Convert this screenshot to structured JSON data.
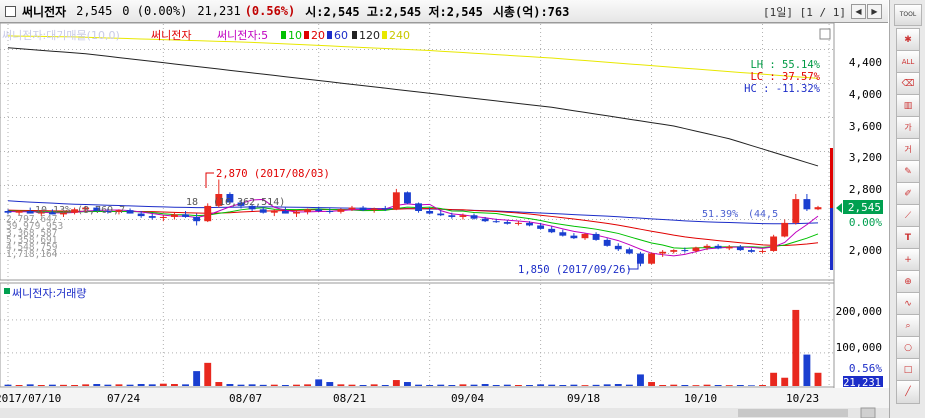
{
  "header": {
    "name": "써니전자",
    "price": "2,545",
    "change": "0 (0.00%)",
    "volume": "21,231",
    "volume_pct": "(0.56%)",
    "ohlc": "시:2,545 고:2,545 저:2,545",
    "mcap": "시총(억):763",
    "period": "[1일] [1 / 1]"
  },
  "legend": {
    "faded": "써니전자:대기매물(10,0)",
    "name": "써니전자",
    "ma_prefix": "써니전자:5",
    "ma10": "10",
    "ma20": "20",
    "ma60": "60",
    "ma120": "120",
    "ma240": "240"
  },
  "stats": {
    "lh": "LH :  55.14%",
    "lc": "LC :  37.57%",
    "hc": "HC : -11.32%"
  },
  "annotations": {
    "high": "2,870 (2017/08/03)",
    "low": "1,850 (2017/09/26)",
    "left1": "18",
    "left2": "(16,362,514)",
    "left3": "10.13%",
    "left4": "(8,769,7",
    "right1": "51.39%",
    "right2": "(44,5",
    "stack": [
      "2,797,647",
      "39,979,953",
      "3,368,587",
      "5,358,691",
      "4,548,759",
      "1,718,164"
    ]
  },
  "price_axis": [
    "4,400",
    "4,000",
    "3,600",
    "3,200",
    "2,800",
    "2,400",
    "2,000"
  ],
  "price_tag": "2,545",
  "pct_tag": "0.00%",
  "volume_panel": {
    "title": "써니전자:거래량",
    "ticks": [
      "200,000",
      "100,000"
    ],
    "tag_pct": "0.56%",
    "tag_vol": "21,231"
  },
  "dates": [
    "2017/07/10",
    "07/24",
    "08/07",
    "08/21",
    "09/04",
    "09/18",
    "10/10",
    "10/23"
  ],
  "toolbar": {
    "top_label": "TOOL"
  },
  "colors": {
    "up": "#e8281e",
    "down": "#1a3fd0",
    "ma5": "#c000c0",
    "ma10": "#00c000",
    "ma20": "#e00000",
    "ma60": "#1c2dc8",
    "ma120": "#222222",
    "ma240": "#e8e800",
    "grid": "#b0b0b0"
  },
  "chart_data": {
    "type": "candlestick",
    "price_range": [
      1700,
      4700
    ],
    "candles": [
      [
        2500,
        2520,
        2460,
        2480
      ],
      [
        2480,
        2510,
        2450,
        2500
      ],
      [
        2500,
        2540,
        2470,
        2470
      ],
      [
        2470,
        2500,
        2440,
        2490
      ],
      [
        2490,
        2520,
        2460,
        2460
      ],
      [
        2460,
        2500,
        2430,
        2480
      ],
      [
        2480,
        2540,
        2460,
        2520
      ],
      [
        2520,
        2560,
        2490,
        2540
      ],
      [
        2540,
        2560,
        2500,
        2500
      ],
      [
        2500,
        2530,
        2470,
        2490
      ],
      [
        2490,
        2520,
        2460,
        2510
      ],
      [
        2510,
        2530,
        2470,
        2470
      ],
      [
        2470,
        2500,
        2420,
        2440
      ],
      [
        2440,
        2470,
        2400,
        2420
      ],
      [
        2420,
        2450,
        2380,
        2430
      ],
      [
        2430,
        2480,
        2400,
        2460
      ],
      [
        2460,
        2500,
        2420,
        2430
      ],
      [
        2430,
        2470,
        2330,
        2380
      ],
      [
        2380,
        2590,
        2370,
        2560
      ],
      [
        2560,
        2870,
        2540,
        2700
      ],
      [
        2700,
        2720,
        2580,
        2600
      ],
      [
        2600,
        2630,
        2530,
        2560
      ],
      [
        2560,
        2580,
        2500,
        2520
      ],
      [
        2520,
        2550,
        2470,
        2480
      ],
      [
        2480,
        2520,
        2440,
        2500
      ],
      [
        2500,
        2540,
        2470,
        2470
      ],
      [
        2470,
        2510,
        2430,
        2490
      ],
      [
        2490,
        2530,
        2460,
        2520
      ],
      [
        2520,
        2550,
        2490,
        2500
      ],
      [
        2500,
        2530,
        2470,
        2490
      ],
      [
        2490,
        2530,
        2470,
        2520
      ],
      [
        2520,
        2560,
        2500,
        2540
      ],
      [
        2540,
        2560,
        2500,
        2510
      ],
      [
        2510,
        2540,
        2480,
        2530
      ],
      [
        2530,
        2560,
        2500,
        2520
      ],
      [
        2520,
        2760,
        2510,
        2720
      ],
      [
        2720,
        2730,
        2580,
        2590
      ],
      [
        2590,
        2600,
        2480,
        2500
      ],
      [
        2500,
        2540,
        2460,
        2470
      ],
      [
        2470,
        2510,
        2440,
        2450
      ],
      [
        2450,
        2480,
        2410,
        2430
      ],
      [
        2430,
        2470,
        2400,
        2450
      ],
      [
        2450,
        2470,
        2400,
        2410
      ],
      [
        2410,
        2430,
        2370,
        2380
      ],
      [
        2380,
        2410,
        2360,
        2370
      ],
      [
        2370,
        2390,
        2340,
        2350
      ],
      [
        2350,
        2380,
        2330,
        2360
      ],
      [
        2360,
        2380,
        2320,
        2330
      ],
      [
        2330,
        2360,
        2280,
        2290
      ],
      [
        2290,
        2320,
        2240,
        2250
      ],
      [
        2250,
        2280,
        2200,
        2210
      ],
      [
        2210,
        2240,
        2170,
        2180
      ],
      [
        2180,
        2240,
        2160,
        2230
      ],
      [
        2230,
        2250,
        2150,
        2160
      ],
      [
        2160,
        2180,
        2080,
        2090
      ],
      [
        2090,
        2120,
        2030,
        2050
      ],
      [
        2050,
        2070,
        1990,
        2000
      ],
      [
        2000,
        2020,
        1850,
        1880
      ],
      [
        1880,
        2010,
        1870,
        2000
      ],
      [
        2000,
        2040,
        1960,
        2020
      ],
      [
        2020,
        2050,
        2000,
        2040
      ],
      [
        2040,
        2070,
        2010,
        2030
      ],
      [
        2030,
        2080,
        2010,
        2070
      ],
      [
        2070,
        2110,
        2040,
        2090
      ],
      [
        2090,
        2110,
        2050,
        2060
      ],
      [
        2060,
        2100,
        2040,
        2080
      ],
      [
        2080,
        2100,
        2030,
        2040
      ],
      [
        2040,
        2060,
        2010,
        2020
      ],
      [
        2020,
        2050,
        2000,
        2030
      ],
      [
        2030,
        2220,
        2020,
        2200
      ],
      [
        2200,
        2400,
        2190,
        2360
      ],
      [
        2360,
        2700,
        2340,
        2640
      ],
      [
        2640,
        2700,
        2500,
        2520
      ],
      [
        2520,
        2560,
        2510,
        2545
      ]
    ],
    "ma5": [
      2495,
      2490,
      2492,
      2485,
      2480,
      2476,
      2482,
      2500,
      2506,
      2510,
      2512,
      2505,
      2488,
      2470,
      2452,
      2440,
      2440,
      2424,
      2450,
      2500,
      2550,
      2588,
      2630,
      2636,
      2544,
      2508,
      2488,
      2490,
      2494,
      2496,
      2504,
      2514,
      2516,
      2520,
      2524,
      2566,
      2584,
      2572,
      2578,
      2504,
      2466,
      2454,
      2436,
      2420,
      2402,
      2392,
      2382,
      2370,
      2350,
      2322,
      2290,
      2260,
      2240,
      2216,
      2186,
      2152,
      2104,
      2050,
      2004,
      1986,
      1972,
      1990,
      2022,
      2054,
      2064,
      2074,
      2076,
      2072,
      2060,
      2078,
      2130,
      2250,
      2340,
      2440
    ],
    "ma10": [
      2500,
      2498,
      2496,
      2494,
      2490,
      2488,
      2486,
      2492,
      2494,
      2494,
      2494,
      2494,
      2490,
      2482,
      2468,
      2458,
      2456,
      2446,
      2452,
      2472,
      2490,
      2514,
      2530,
      2538,
      2520,
      2518,
      2516,
      2520,
      2524,
      2518,
      2516,
      2512,
      2504,
      2506,
      2508,
      2530,
      2546,
      2540,
      2546,
      2530,
      2500,
      2498,
      2482,
      2476,
      2470,
      2448,
      2428,
      2410,
      2388,
      2360,
      2340,
      2320,
      2304,
      2286,
      2262,
      2236,
      2198,
      2160,
      2124,
      2100,
      2066,
      2060,
      2068,
      2068,
      2076,
      2080,
      2080,
      2080,
      2072,
      2082,
      2100,
      2140,
      2180,
      2230
    ],
    "ma20": [
      2510,
      2508,
      2506,
      2504,
      2502,
      2500,
      2498,
      2496,
      2494,
      2494,
      2494,
      2494,
      2494,
      2492,
      2488,
      2484,
      2480,
      2476,
      2474,
      2476,
      2480,
      2488,
      2494,
      2500,
      2502,
      2506,
      2508,
      2512,
      2516,
      2516,
      2516,
      2516,
      2514,
      2514,
      2514,
      2520,
      2526,
      2526,
      2530,
      2524,
      2516,
      2514,
      2506,
      2500,
      2494,
      2486,
      2476,
      2464,
      2450,
      2436,
      2420,
      2406,
      2390,
      2372,
      2354,
      2334,
      2310,
      2286,
      2262,
      2240,
      2216,
      2196,
      2180,
      2166,
      2152,
      2140,
      2126,
      2114,
      2102,
      2096,
      2094,
      2102,
      2112,
      2126
    ],
    "ma60": [
      2620,
      2612,
      2604,
      2598,
      2592,
      2586,
      2580,
      2576,
      2572,
      2568,
      2564,
      2560,
      2556,
      2552,
      2548,
      2544,
      2542,
      2540,
      2540,
      2542,
      2544,
      2546,
      2548,
      2548,
      2548,
      2546,
      2544,
      2542,
      2540,
      2538,
      2536,
      2534,
      2532,
      2530,
      2528,
      2528,
      2528,
      2526,
      2524,
      2520,
      2516,
      2512,
      2508,
      2504,
      2500,
      2494,
      2488,
      2482,
      2476,
      2470,
      2464,
      2458,
      2452,
      2446,
      2440,
      2432,
      2424,
      2416,
      2408,
      2400,
      2392,
      2384,
      2378,
      2372,
      2368,
      2364,
      2360,
      2356,
      2352,
      2350,
      2350,
      2352,
      2356,
      2360
    ],
    "ma120": [
      4420,
      4410,
      4400,
      4390,
      4380,
      4370,
      4360,
      4350,
      4335,
      4320,
      4305,
      4290,
      4275,
      4260,
      4245,
      4230,
      4215,
      4200,
      4185,
      4170,
      4155,
      4140,
      4125,
      4110,
      4095,
      4080,
      4065,
      4050,
      4035,
      4020,
      4005,
      3990,
      3975,
      3960,
      3945,
      3930,
      3915,
      3900,
      3885,
      3870,
      3855,
      3840,
      3825,
      3810,
      3795,
      3780,
      3765,
      3750,
      3735,
      3720,
      3700,
      3680,
      3660,
      3640,
      3620,
      3600,
      3580,
      3560,
      3540,
      3520,
      3500,
      3470,
      3440,
      3410,
      3380,
      3350,
      3310,
      3270,
      3230,
      3190,
      3150,
      3110,
      3070,
      3030
    ],
    "ma240": [
      4560,
      4558,
      4556,
      4554,
      4552,
      4550,
      4548,
      4544,
      4540,
      4536,
      4532,
      4528,
      4524,
      4520,
      4516,
      4512,
      4508,
      4504,
      4500,
      4496,
      4492,
      4488,
      4484,
      4478,
      4472,
      4466,
      4460,
      4454,
      4448,
      4442,
      4436,
      4430,
      4424,
      4418,
      4412,
      4406,
      4400,
      4394,
      4388,
      4380,
      4372,
      4364,
      4356,
      4348,
      4340,
      4332,
      4324,
      4316,
      4308,
      4300,
      4290,
      4280,
      4270,
      4260,
      4250,
      4240,
      4230,
      4220,
      4210,
      4200,
      4190,
      4180,
      4170,
      4160,
      4150,
      4140,
      4130,
      4120,
      4110,
      4100,
      4090,
      4080,
      4070,
      4060
    ],
    "volume": [
      4000,
      3000,
      5000,
      3000,
      4000,
      3500,
      3000,
      5000,
      6000,
      4000,
      5000,
      4000,
      6000,
      5000,
      7000,
      6000,
      5000,
      45000,
      70000,
      12000,
      6000,
      4000,
      5000,
      3500,
      4000,
      3000,
      4000,
      5000,
      20000,
      12000,
      5000,
      4000,
      3000,
      5000,
      3000,
      18000,
      12000,
      4000,
      3000,
      4000,
      3000,
      5000,
      4000,
      6000,
      3000,
      4000,
      3000,
      3000,
      5000,
      4000,
      3000,
      4000,
      2500,
      3500,
      5000,
      6000,
      4000,
      35000,
      12000,
      3000,
      4000,
      3000,
      2500,
      4000,
      3000,
      2500,
      3000,
      2000,
      3000,
      40000,
      25000,
      230000,
      95000,
      40000
    ],
    "y_ticks": [
      4400,
      4000,
      3600,
      3200,
      2800,
      2400,
      2000
    ],
    "volume_range": [
      0,
      260000
    ]
  }
}
